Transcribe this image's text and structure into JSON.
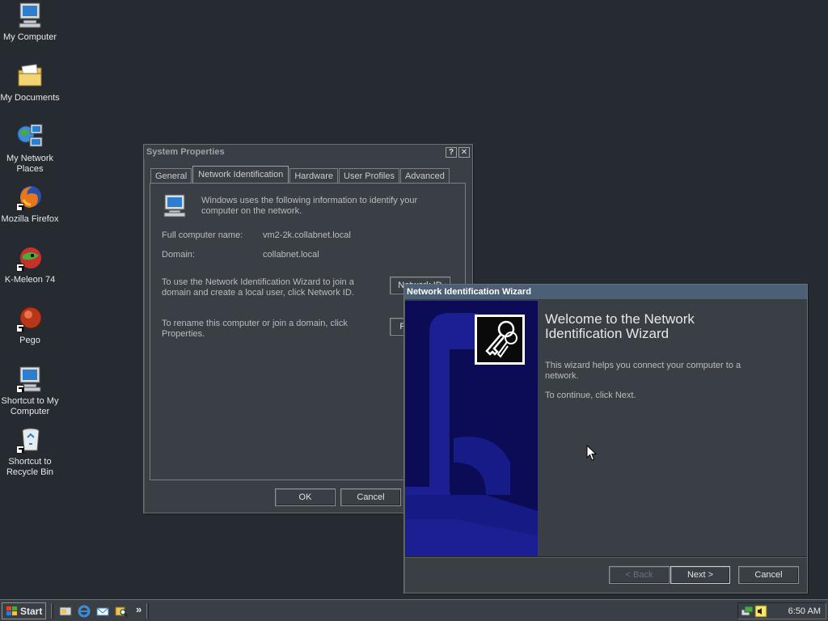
{
  "desktop": {
    "icons": [
      {
        "label": "My Computer"
      },
      {
        "label": "My Documents"
      },
      {
        "label": "My Network Places"
      },
      {
        "label": "Mozilla Firefox"
      },
      {
        "label": "K-Meleon 74"
      },
      {
        "label": "Pego"
      },
      {
        "label": "Shortcut to My Computer"
      },
      {
        "label": "Shortcut to Recycle Bin"
      }
    ]
  },
  "system_properties": {
    "title": "System Properties",
    "help_glyph": "?",
    "close_glyph": "✕",
    "tabs": [
      {
        "label": "General"
      },
      {
        "label": "Network Identification"
      },
      {
        "label": "Hardware"
      },
      {
        "label": "User Profiles"
      },
      {
        "label": "Advanced"
      }
    ],
    "intro": "Windows uses the following information to identify your computer on the network.",
    "full_name_label": "Full computer name:",
    "full_name_value": "vm2-2k.collabnet.local",
    "domain_label": "Domain:",
    "domain_value": "collabnet.local",
    "wizard_text": "To use the Network Identification Wizard to join a domain and create a local user, click Network ID.",
    "network_id_button": "Network ID",
    "rename_text": "To rename this computer or join a domain, click Properties.",
    "properties_button": "Properties",
    "ok_button": "OK",
    "cancel_button": "Cancel"
  },
  "wizard": {
    "title": "Network Identification Wizard",
    "heading": "Welcome to the Network Identification Wizard",
    "body1": "This wizard helps you connect your computer to a network.",
    "body2": "To continue, click Next.",
    "back_button": "< Back",
    "next_button": "Next >",
    "cancel_button": "Cancel"
  },
  "taskbar": {
    "start_label": "Start",
    "chevron": "»",
    "clock": "6:50 AM"
  },
  "colors": {
    "desktop": "#262b31",
    "window": "#3a3f45",
    "wizard_side": "#0c0c56",
    "wizard_title": "#4b5f76"
  }
}
